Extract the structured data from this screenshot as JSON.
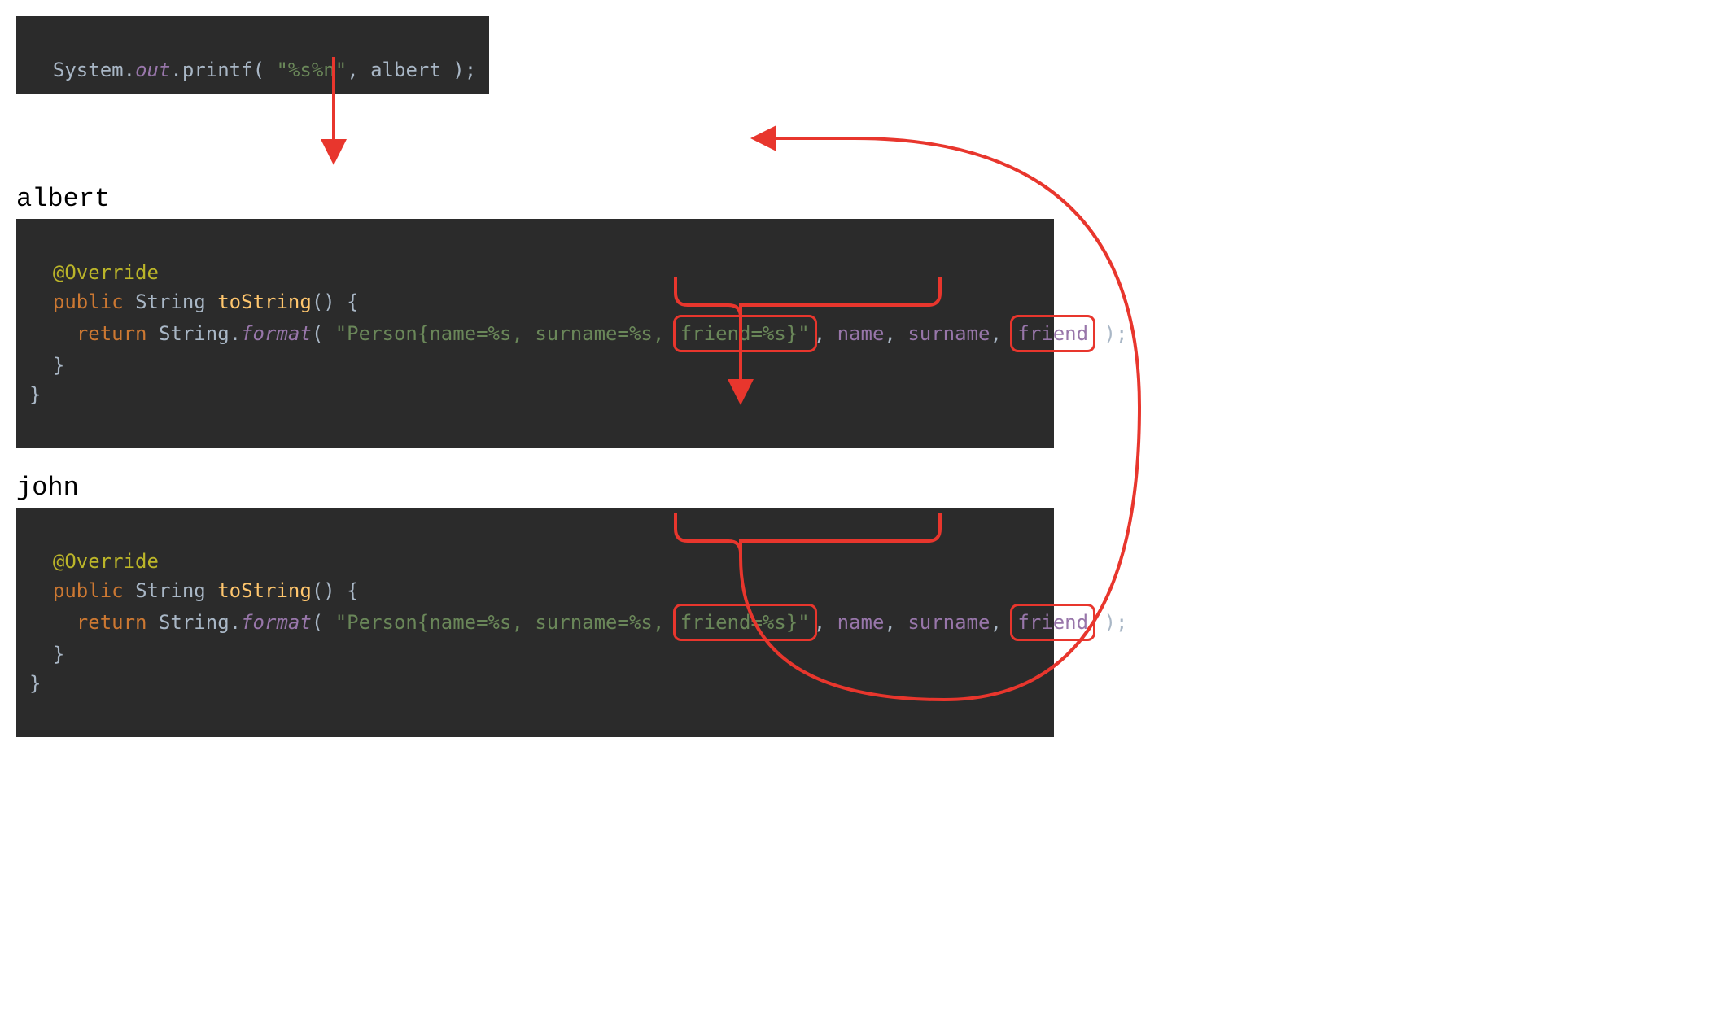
{
  "colors": {
    "highlight": "#e8362d",
    "code_bg": "#2b2b2b",
    "keyword": "#cc7832",
    "string": "#6a8759",
    "annotation": "#bbb529",
    "method": "#ffc66d",
    "identifier": "#9876aa",
    "default": "#a9b7c6"
  },
  "top_call": {
    "tokens": {
      "class": "System",
      "dot1": ".",
      "out": "out",
      "dot2": ".",
      "printf": "printf",
      "open": "( ",
      "fmt": "\"%s%n\"",
      "comma": ", ",
      "arg": "albert",
      "close": " );"
    }
  },
  "blocks": [
    {
      "label": "albert",
      "code": {
        "annotation": "@Override",
        "kw_public": "public",
        "type_string": "String",
        "method_name": "toString",
        "sig_rest": "() {",
        "kw_return": "return",
        "class_string": "String",
        "dot": ".",
        "format": "format",
        "open": "( ",
        "fmt_prefix": "\"Person{name=%s, surname=%s, ",
        "fmt_highlight": "friend=%s}\"",
        "comma1": ", ",
        "arg_name": "name",
        "comma2": ", ",
        "arg_surname": "surname",
        "comma3": ", ",
        "arg_friend": "friend",
        "close": " );",
        "brace1": "  }",
        "brace2": "}"
      }
    },
    {
      "label": "john",
      "code": {
        "annotation": "@Override",
        "kw_public": "public",
        "type_string": "String",
        "method_name": "toString",
        "sig_rest": "() {",
        "kw_return": "return",
        "class_string": "String",
        "dot": ".",
        "format": "format",
        "open": "( ",
        "fmt_prefix": "\"Person{name=%s, surname=%s, ",
        "fmt_highlight": "friend=%s}\"",
        "comma1": ", ",
        "arg_name": "name",
        "comma2": ", ",
        "arg_surname": "surname",
        "comma3": ", ",
        "arg_friend": "friend",
        "close": " );",
        "brace1": "  }",
        "brace2": "}"
      }
    }
  ]
}
